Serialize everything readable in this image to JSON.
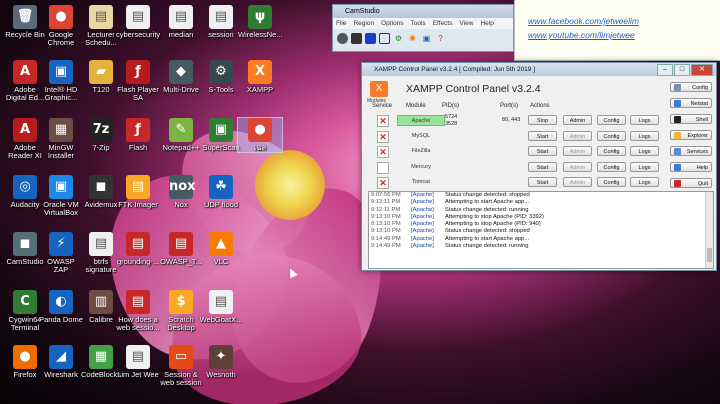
{
  "desktop_icons": [
    {
      "id": "recycle",
      "label": "Recycle Bin",
      "glyph": "🗑",
      "color": "#5a6a7a"
    },
    {
      "id": "chrome",
      "label": "Google Chrome",
      "glyph": "●",
      "color": "#db4437"
    },
    {
      "id": "lecturer",
      "label": "Lecturer Schedu...",
      "glyph": "▤",
      "color": "#e9d8a6"
    },
    {
      "id": "cyber",
      "label": "cybersecurity",
      "glyph": "▤",
      "color": "#f0f0f0"
    },
    {
      "id": "median",
      "label": "median",
      "glyph": "▤",
      "color": "#f0f0f0"
    },
    {
      "id": "session",
      "label": "session",
      "glyph": "▤",
      "color": "#f0f0f0"
    },
    {
      "id": "wireless",
      "label": "WirelessNe...",
      "glyph": "ψ",
      "color": "#2e7d32"
    },
    {
      "id": "adobedd",
      "label": "Adobe Digital Ed...",
      "glyph": "A",
      "color": "#c62828"
    },
    {
      "id": "intelhd",
      "label": "Intel® HD Graphic...",
      "glyph": "▣",
      "color": "#1565c0"
    },
    {
      "id": "t120",
      "label": "T120",
      "glyph": "▰",
      "color": "#e3b23c"
    },
    {
      "id": "flashplayer",
      "label": "Flash Player SA",
      "glyph": "ƒ",
      "color": "#b71c1c"
    },
    {
      "id": "multidrive",
      "label": "Multi-Drive",
      "glyph": "◆",
      "color": "#455a64"
    },
    {
      "id": "stools",
      "label": "S-Tools",
      "glyph": "⚙",
      "color": "#37474f"
    },
    {
      "id": "xampp",
      "label": "XAMPP",
      "glyph": "X",
      "color": "#fb7a24"
    },
    {
      "id": "adobereader",
      "label": "Adobe Reader XI",
      "glyph": "A",
      "color": "#b71c1c"
    },
    {
      "id": "mingw",
      "label": "MinGW Installer",
      "glyph": "▦",
      "color": "#6d4c41"
    },
    {
      "id": "7zip",
      "label": "7-Zip",
      "glyph": "7z",
      "color": "#222"
    },
    {
      "id": "flash",
      "label": "Flash",
      "glyph": "ƒ",
      "color": "#c62828"
    },
    {
      "id": "notepadpp",
      "label": "Notepad++",
      "glyph": "✎",
      "color": "#7cb342"
    },
    {
      "id": "superscan",
      "label": "SuperScan",
      "glyph": "▣",
      "color": "#2e7d32"
    },
    {
      "id": "chromeshort",
      "label": "เฉล",
      "glyph": "●",
      "color": "#db4437"
    },
    {
      "id": "audacity",
      "label": "Audacity",
      "glyph": "◎",
      "color": "#1565c0"
    },
    {
      "id": "vbox",
      "label": "Oracle VM VirtualBox",
      "glyph": "▣",
      "color": "#1e88e5"
    },
    {
      "id": "avidemux",
      "label": "Avidemux",
      "glyph": "◼",
      "color": "#333"
    },
    {
      "id": "ftk",
      "label": "FTK Imager",
      "glyph": "▤",
      "color": "#f9a825"
    },
    {
      "id": "nox",
      "label": "Nox",
      "glyph": "nox",
      "color": "#455a64"
    },
    {
      "id": "udpflood",
      "label": "UDP flood",
      "glyph": "☘",
      "color": "#1565c0"
    },
    {
      "id": "camstudio",
      "label": "CamStudio",
      "glyph": "◼",
      "color": "#546e7a"
    },
    {
      "id": "owaspzap",
      "label": "OWASP ZAP",
      "glyph": "⚡",
      "color": "#1565c0"
    },
    {
      "id": "btrfs",
      "label": "btrfs signature",
      "glyph": "▤",
      "color": "#f0f0f0"
    },
    {
      "id": "grounding",
      "label": "grounding-...",
      "glyph": "▤",
      "color": "#c62828"
    },
    {
      "id": "owasptop",
      "label": "OWASP_T...",
      "glyph": "▤",
      "color": "#c62828"
    },
    {
      "id": "vlc",
      "label": "VLC",
      "glyph": "▲",
      "color": "#f57c00"
    },
    {
      "id": "cygwin",
      "label": "Cygwin64 Terminal",
      "glyph": "C",
      "color": "#2e7d32"
    },
    {
      "id": "panda",
      "label": "Panda Dome",
      "glyph": "◐",
      "color": "#1565c0"
    },
    {
      "id": "calibre",
      "label": "Calibre",
      "glyph": "▥",
      "color": "#6d4c41"
    },
    {
      "id": "websession",
      "label": "How does a web sessio...",
      "glyph": "▤",
      "color": "#c62828"
    },
    {
      "id": "scratch",
      "label": "Scratch Desktop",
      "glyph": "$",
      "color": "#f9a825"
    },
    {
      "id": "webgoat",
      "label": "WebGoatX...",
      "glyph": "▤",
      "color": "#f0f0f0"
    },
    {
      "id": "firefox",
      "label": "Firefox",
      "glyph": "●",
      "color": "#ef6c00"
    },
    {
      "id": "wireshark",
      "label": "Wireshark",
      "glyph": "◢",
      "color": "#1565c0"
    },
    {
      "id": "codeblocks",
      "label": "CodeBlocks",
      "glyph": "▦",
      "color": "#43a047"
    },
    {
      "id": "limjetwee",
      "label": "Lim Jet Wee",
      "glyph": "▤",
      "color": "#f0f0f0"
    },
    {
      "id": "sessionweb",
      "label": "Session & web session",
      "glyph": "▭",
      "color": "#e64a19"
    },
    {
      "id": "wesnoth",
      "label": "Wesnoth",
      "glyph": "✦",
      "color": "#5d4037"
    }
  ],
  "links": {
    "facebook": "www.facebook.com/jetweelim",
    "youtube": "www.youtube.com/limjetwee"
  },
  "camstudio": {
    "title": "CamStudio",
    "menu": [
      "File",
      "Region",
      "Options",
      "Tools",
      "Effects",
      "View",
      "Help"
    ]
  },
  "xampp": {
    "window_title": "XAMPP Control Panel v3.2.4   [ Compiled: Jun 5th 2019 ]",
    "heading": "XAMPP Control Panel v3.2.4",
    "modules_label": "Modules",
    "headers": {
      "service": "Service",
      "module": "Module",
      "pids": "PID(s)",
      "ports": "Port(s)",
      "actions": "Actions"
    },
    "side_buttons": [
      {
        "id": "config",
        "label": "Config",
        "color": "#7a8fa8"
      },
      {
        "id": "netstat",
        "label": "Netstat",
        "color": "#3a7bd5"
      },
      {
        "id": "shell",
        "label": "Shell",
        "color": "#222"
      },
      {
        "id": "explorer",
        "label": "Explorer",
        "color": "#f0b43c"
      },
      {
        "id": "services",
        "label": "Services",
        "color": "#5b8bd5"
      },
      {
        "id": "help",
        "label": "Help",
        "color": "#3a7bd5"
      },
      {
        "id": "quit",
        "label": "Quit",
        "color": "#c62828"
      }
    ],
    "modules": [
      {
        "name": "Apache",
        "pid1": "5724",
        "pid2": "3528",
        "ports": "80, 443",
        "running": true,
        "action": "Stop",
        "admin": "Admin",
        "config": "Config",
        "logs": "Logs",
        "service_mark": "✕"
      },
      {
        "name": "MySQL",
        "pid1": "",
        "pid2": "",
        "ports": "",
        "running": false,
        "action": "Start",
        "admin": "Admin",
        "config": "Config",
        "logs": "Logs",
        "service_mark": "✕"
      },
      {
        "name": "FileZilla",
        "pid1": "",
        "pid2": "",
        "ports": "",
        "running": false,
        "action": "Start",
        "admin": "Admin",
        "config": "Config",
        "logs": "Logs",
        "service_mark": "✕"
      },
      {
        "name": "Mercury",
        "pid1": "",
        "pid2": "",
        "ports": "",
        "running": false,
        "action": "Start",
        "admin": "Admin",
        "config": "Config",
        "logs": "Logs",
        "service_mark": ""
      },
      {
        "name": "Tomcat",
        "pid1": "",
        "pid2": "",
        "ports": "",
        "running": false,
        "action": "Start",
        "admin": "Admin",
        "config": "Config",
        "logs": "Logs",
        "service_mark": "✕"
      }
    ],
    "log": [
      {
        "time": "9:07:56 PM",
        "module": "[Apache]",
        "msg": "Status change detected: stopped"
      },
      {
        "time": "9:12:11 PM",
        "module": "[Apache]",
        "msg": "Attempting to start Apache app..."
      },
      {
        "time": "9:12:11 PM",
        "module": "[Apache]",
        "msg": "Status change detected: running"
      },
      {
        "time": "9:13:10 PM",
        "module": "[Apache]",
        "msg": "Attempting to stop Apache (PID: 3392)"
      },
      {
        "time": "9:13:10 PM",
        "module": "[Apache]",
        "msg": "Attempting to stop Apache (PID: 940)"
      },
      {
        "time": "9:13:10 PM",
        "module": "[Apache]",
        "msg": "Status change detected: stopped"
      },
      {
        "time": "9:14:49 PM",
        "module": "[Apache]",
        "msg": "Attempting to start Apache app..."
      },
      {
        "time": "9:14:49 PM",
        "module": "[Apache]",
        "msg": "Status change detected: running"
      }
    ]
  }
}
